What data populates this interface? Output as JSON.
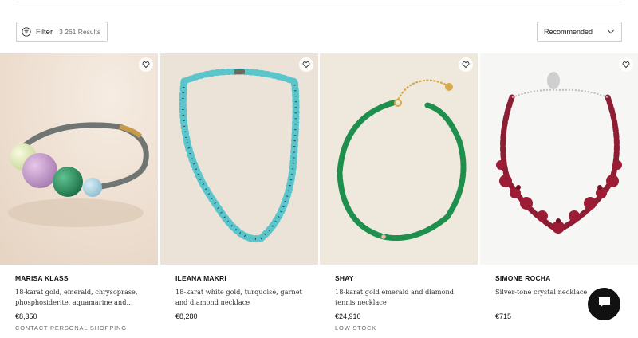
{
  "toolbar": {
    "filter_label": "Filter",
    "results_label": "3 261 Results",
    "sort_label": "Recommended"
  },
  "products": [
    {
      "designer": "MARISA KLASS",
      "description": "18-karat gold, emerald, chrysoprase, phosphosiderite, aquamarine and…",
      "price": "€8,350",
      "flag": "CONTACT PERSONAL SHOPPING"
    },
    {
      "designer": "ILEANA MAKRI",
      "description": "18-karat white gold, turquoise, garnet and diamond necklace",
      "price": "€8,280",
      "flag": ""
    },
    {
      "designer": "SHAY",
      "description": "18-karat gold emerald and diamond tennis necklace",
      "price": "€24,910",
      "flag": "LOW STOCK"
    },
    {
      "designer": "SIMONE ROCHA",
      "description": "Silver-tone crystal necklace",
      "price": "€715",
      "flag": ""
    }
  ],
  "icons": {
    "filter": "filter-icon",
    "chevron": "chevron-down-icon",
    "wishlist": "heart-icon",
    "chat": "chat-icon"
  }
}
